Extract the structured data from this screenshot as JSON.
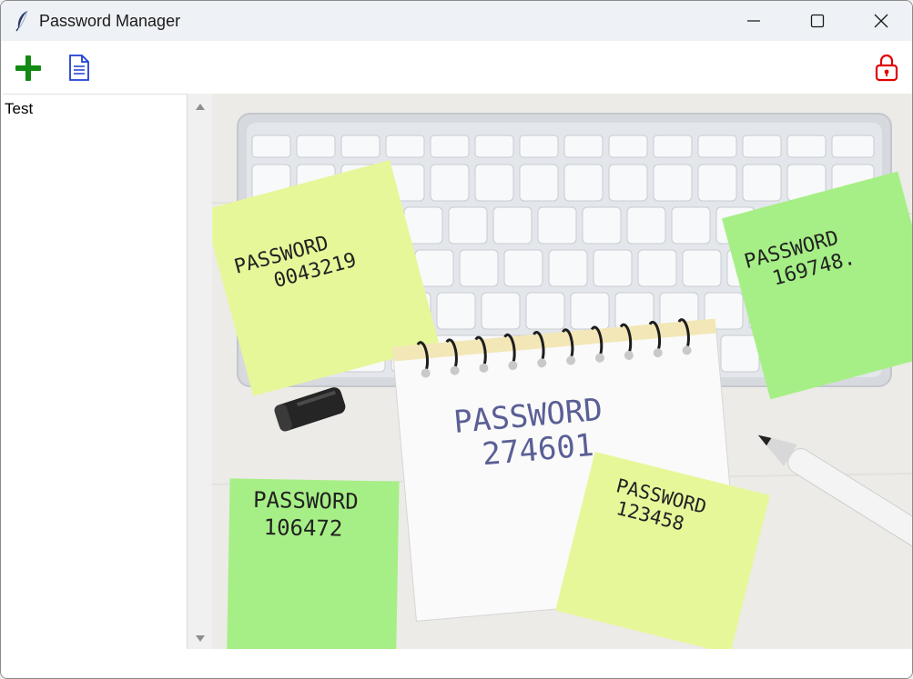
{
  "window": {
    "title": "Password Manager",
    "app_icon": "feather-icon",
    "controls": [
      "minimize-icon",
      "maximize-icon",
      "close-icon"
    ]
  },
  "toolbar": {
    "buttons": [
      {
        "icon": "add-icon",
        "color": "#138a13"
      },
      {
        "icon": "document-icon",
        "color": "#1f3fd1"
      },
      {
        "icon": "lock-icon",
        "color": "#e00000"
      }
    ]
  },
  "sidebar": {
    "items": [
      {
        "label": "Test"
      }
    ]
  },
  "image": {
    "notes": [
      {
        "line1": "PASSWORD",
        "line2": "0043219"
      },
      {
        "line1": "PASSWORD",
        "line2": "169748."
      },
      {
        "line1": "PASSWORD",
        "line2": "274601"
      },
      {
        "line1": "PASSWORD",
        "line2": "106472"
      },
      {
        "line1": "PASSWORD",
        "line2": "123458"
      }
    ],
    "colors": {
      "yellow_note": "#e6f79a",
      "green_note": "#a6ef86",
      "keyboard": "#dcdfe3",
      "desk": "#ecebe7"
    }
  }
}
